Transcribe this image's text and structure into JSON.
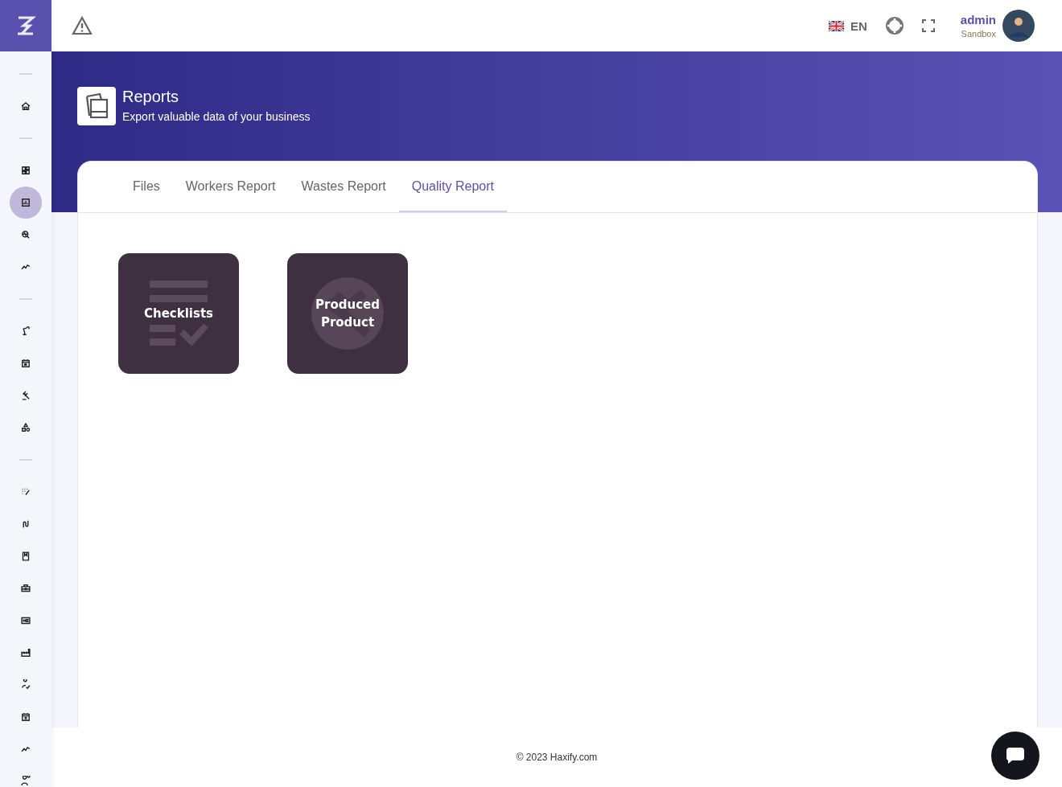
{
  "sidebar": {
    "items": [
      {
        "kind": "divider"
      },
      {
        "kind": "link",
        "selected": false
      },
      {
        "kind": "divider"
      },
      {
        "kind": "link",
        "selected": false
      },
      {
        "kind": "link",
        "selected": true
      },
      {
        "kind": "link",
        "selected": false
      },
      {
        "kind": "link",
        "selected": false
      },
      {
        "kind": "divider"
      },
      {
        "kind": "link",
        "selected": false
      },
      {
        "kind": "link",
        "selected": false
      },
      {
        "kind": "link",
        "selected": false
      },
      {
        "kind": "link",
        "selected": false
      },
      {
        "kind": "divider"
      },
      {
        "kind": "link",
        "selected": false
      },
      {
        "kind": "link",
        "selected": false
      },
      {
        "kind": "link",
        "selected": false
      },
      {
        "kind": "link",
        "selected": false
      },
      {
        "kind": "link",
        "selected": false
      },
      {
        "kind": "link",
        "selected": false
      },
      {
        "kind": "link",
        "selected": false
      },
      {
        "kind": "link",
        "selected": false
      },
      {
        "kind": "link",
        "selected": false
      },
      {
        "kind": "link",
        "selected": false
      }
    ]
  },
  "topbar": {
    "language": "EN",
    "user": {
      "name": "admin",
      "role": "Sandbox"
    }
  },
  "header": {
    "title": "Reports",
    "subtitle": "Export valuable data of your business"
  },
  "tabs": [
    {
      "label": "Files",
      "selected": false
    },
    {
      "label": "Workers Report",
      "selected": false
    },
    {
      "label": "Wastes Report",
      "selected": false
    },
    {
      "label": "Quality Report",
      "selected": true
    }
  ],
  "cards": [
    {
      "kind": "checklist",
      "label": "Checklists"
    },
    {
      "kind": "product",
      "label": "Produced Product"
    }
  ],
  "footer": {
    "text": "© 2023 Haxify.com"
  }
}
